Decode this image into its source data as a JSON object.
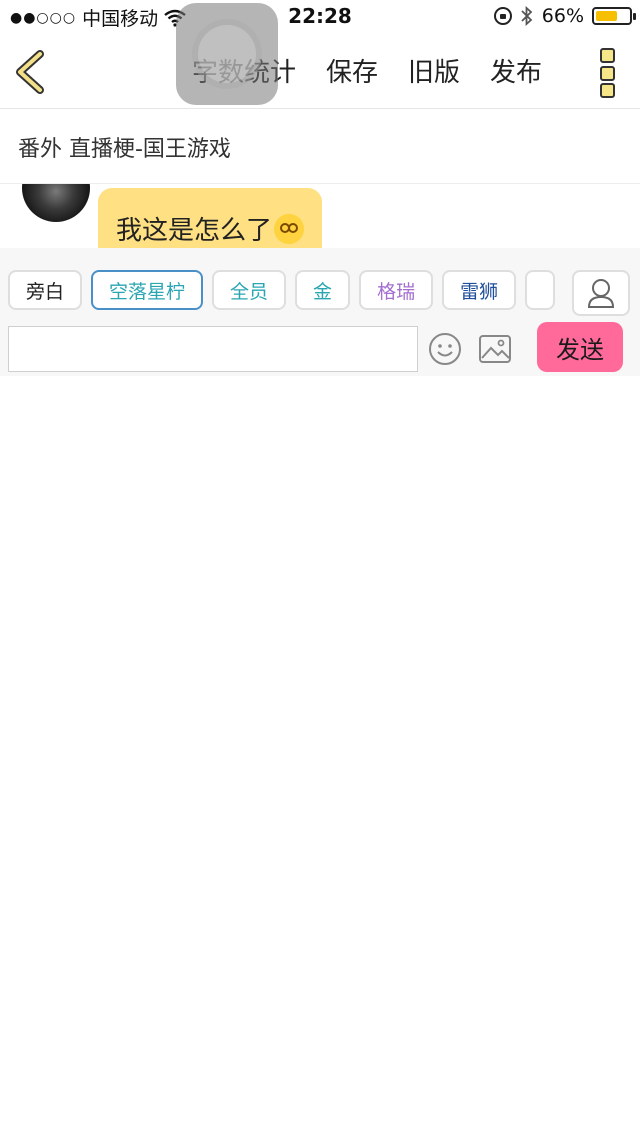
{
  "status_bar": {
    "signal": "●●○○○",
    "carrier": "中国移动",
    "time": "22:28",
    "battery_percent": "66%",
    "battery_level": 0.66
  },
  "nav": {
    "actions": [
      "字数统计",
      "保存",
      "旧版",
      "发布"
    ]
  },
  "chapter": {
    "title": "番外 直播梗-国王游戏"
  },
  "chat": {
    "message": "我这是怎么了",
    "emoji": "flushed-face-emoji"
  },
  "role_chips": [
    {
      "label": "旁白",
      "color": "#222222"
    },
    {
      "label": "空落星柠",
      "color": "#2aa6b3",
      "active": true
    },
    {
      "label": "全员",
      "color": "#2aa6b3"
    },
    {
      "label": "金",
      "color": "#2aa6b3"
    },
    {
      "label": "格瑞",
      "color": "#a46fd0"
    },
    {
      "label": "雷狮",
      "color": "#1f4f9a"
    }
  ],
  "composer": {
    "input_value": "",
    "send_label": "发送",
    "send_color": "#ff6a9b"
  }
}
